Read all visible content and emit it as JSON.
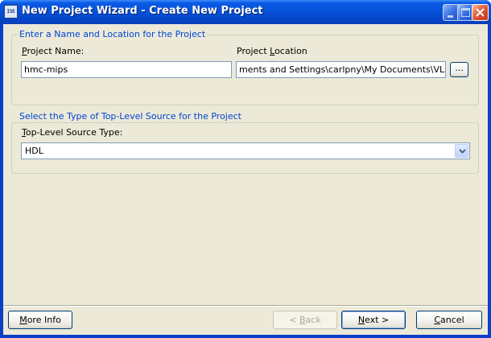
{
  "window": {
    "title": "New Project Wizard - Create New Project",
    "app_icon_text": "ISE"
  },
  "project_group": {
    "caption": "Enter a Name and Location for the Project",
    "name_label_mnemonic": "P",
    "name_label_rest": "roject Name:",
    "name_value": "hmc-mips",
    "location_label_pre": "Project ",
    "location_label_mnemonic": "L",
    "location_label_post": "ocation",
    "location_value": "ments and Settings\\carlpny\\My Documents\\VLSI\\svn",
    "browse_label": "..."
  },
  "source_group": {
    "caption": "Select the Type of Top-Level Source for the Project",
    "type_label_mnemonic": "T",
    "type_label_rest": "op-Level Source Type:",
    "type_value": "HDL"
  },
  "footer": {
    "more_info_mnemonic": "M",
    "more_info_rest": "ore Info",
    "back_pre": "< ",
    "back_mnemonic": "B",
    "back_rest": "ack",
    "next_mnemonic": "N",
    "next_rest": "ext >",
    "cancel_mnemonic": "C",
    "cancel_rest": "ancel"
  }
}
